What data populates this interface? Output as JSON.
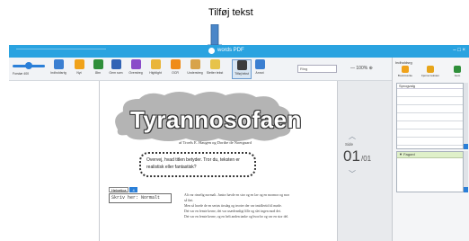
{
  "annotation": {
    "label": "Tilføj tekst",
    "arrow_color": "#4a86c8"
  },
  "titlebar": {
    "title": "words PDF",
    "controls": "– □ ×",
    "color": "#2aa3e0"
  },
  "toolbar": {
    "zoom_label": "Forstør 400",
    "tools": [
      {
        "name": "tool-indhold",
        "label": "Indholdsrtg",
        "color": "#3b7fd1"
      },
      {
        "name": "tool-nyt",
        "label": "Nyt",
        "color": "#f0a21a"
      },
      {
        "name": "tool-aabn",
        "label": "Åbn",
        "color": "#2f8f3a"
      },
      {
        "name": "tool-gem",
        "label": "Gem som",
        "color": "#3163b5"
      },
      {
        "name": "tool-overstreg",
        "label": "Overstreg",
        "color": "#8a4bc9"
      },
      {
        "name": "tool-highlight",
        "label": "Highlight",
        "color": "#e9b53a"
      },
      {
        "name": "tool-ocr",
        "label": "OCR",
        "color": "#f08c1a"
      },
      {
        "name": "tool-understreg",
        "label": "Understreg",
        "color": "#d8a34a"
      },
      {
        "name": "tool-slet",
        "label": "Sletter tekst",
        "color": "#e7c34a"
      },
      {
        "name": "tool-tilfoej-tekst",
        "label": "Tilføj tekst",
        "color": "#3d3d3d",
        "active": true
      },
      {
        "name": "tool-annot",
        "label": "Annot",
        "color": "#3b7fd1"
      }
    ],
    "font_value": "Ring",
    "zoom_value": "100%"
  },
  "document": {
    "title": "Tyrannosofaen",
    "byline": "af Troels E. Haugen og Dorthe de Noerguard",
    "bubble_text": "Overvej, hvad titlen betyder. Tror du, teksten er realistisk eller fantastisk?",
    "textbox_font": "Helvetica",
    "textbox_size": "4",
    "textbox_value": "Skriv her: Normalt",
    "body_paragraphs": [
      "Alt var rimelig normalt. Junior havde en stor og en lav og en mormor og mor så fint.",
      "Men så havde de en seriøs tirsdag og teorier der var imidlertid til møde.",
      "Det var en femte kerne, det var usædvanligt lille og slet ingen mod det.",
      "Det var en femte kerne, og en helt anden tanke og hvorfor og var en stor del."
    ]
  },
  "pager": {
    "label": "Side",
    "current": "01",
    "total": "/01"
  },
  "right_panel": {
    "header": "Indholdsrg",
    "buttons": [
      {
        "name": "panel-btn-bookmark",
        "label": "Bookmærke",
        "color": "#f0a21a"
      },
      {
        "name": "panel-btn-fjern",
        "label": "Fjernet teksten",
        "color": "#e7a51a"
      },
      {
        "name": "panel-btn-gem",
        "label": "Gem",
        "color": "#2f8f3a"
      }
    ],
    "list_header": "Sprogvalg",
    "rows": 7,
    "section_label": "Fagord"
  }
}
